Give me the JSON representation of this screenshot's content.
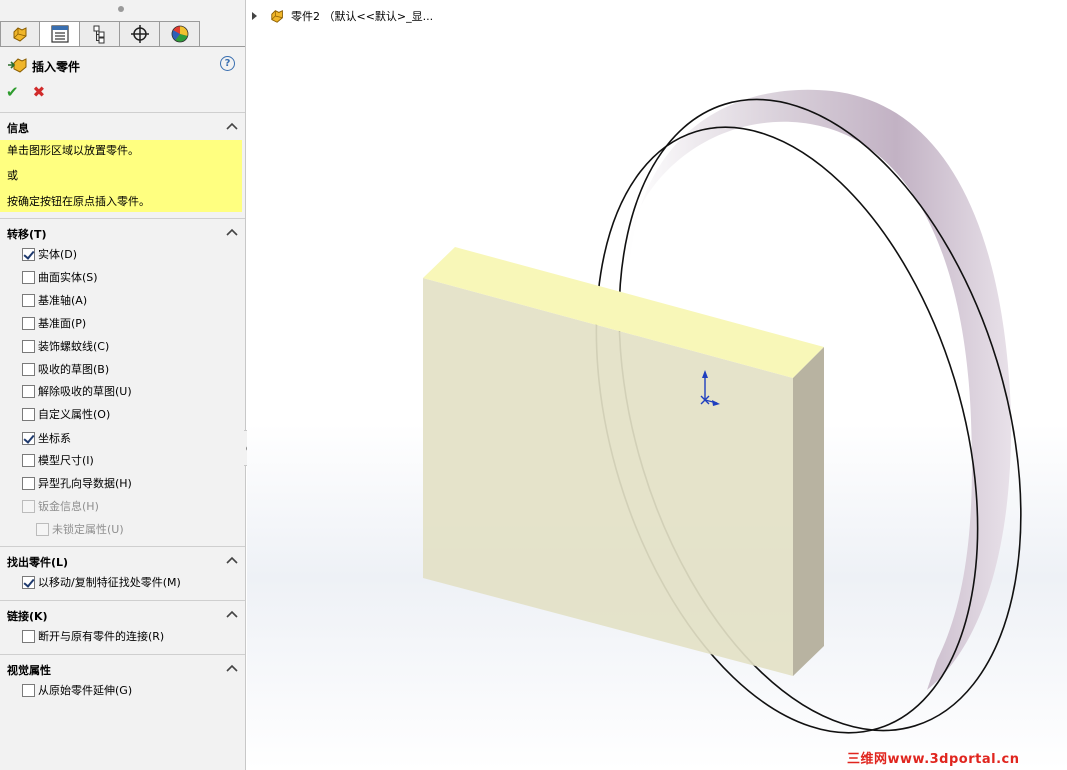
{
  "panel": {
    "tabs": [
      {
        "icon": "feature-manager-icon"
      },
      {
        "icon": "property-manager-icon"
      },
      {
        "icon": "configuration-manager-icon"
      },
      {
        "icon": "dimxpert-icon"
      },
      {
        "icon": "display-manager-icon"
      }
    ],
    "title": "插入零件",
    "help_icon": "?",
    "ok_icon": "✔",
    "cancel_icon": "✖",
    "info": {
      "title": "信息",
      "lines": [
        "单击图形区域以放置零件。",
        "或",
        "按确定按钮在原点插入零件。"
      ]
    },
    "transfer": {
      "title": "转移(T)",
      "items": [
        {
          "label": "实体(D)",
          "checked": true,
          "disabled": false
        },
        {
          "label": "曲面实体(S)",
          "checked": false,
          "disabled": false
        },
        {
          "label": "基准轴(A)",
          "checked": false,
          "disabled": false
        },
        {
          "label": "基准面(P)",
          "checked": false,
          "disabled": false
        },
        {
          "label": "装饰螺蚊线(C)",
          "checked": false,
          "disabled": false
        },
        {
          "label": "吸收的草图(B)",
          "checked": false,
          "disabled": false
        },
        {
          "label": "解除吸收的草图(U)",
          "checked": false,
          "disabled": false
        },
        {
          "label": "自定义属性(O)",
          "checked": false,
          "disabled": false
        },
        {
          "label": "坐标系",
          "checked": true,
          "disabled": false
        },
        {
          "label": "模型尺寸(I)",
          "checked": false,
          "disabled": false
        },
        {
          "label": "异型孔向导数据(H)",
          "checked": false,
          "disabled": false
        },
        {
          "label": "钣金信息(H)",
          "checked": false,
          "disabled": true
        },
        {
          "label": "未锁定属性(U)",
          "checked": false,
          "disabled": true
        }
      ]
    },
    "find_part": {
      "title": "找出零件(L)",
      "items": [
        {
          "label": "以移动/复制特征找处零件(M)",
          "checked": true
        }
      ]
    },
    "link": {
      "title": "链接(K)",
      "items": [
        {
          "label": "断开与原有零件的连接(R)",
          "checked": false
        }
      ]
    },
    "visual": {
      "title": "视觉属性",
      "items": [
        {
          "label": "从原始零件延伸(G)",
          "checked": false
        }
      ]
    }
  },
  "graphics": {
    "breadcrumb": "零件2 （默认<<默认>_显...",
    "breadcrumb_icon": "part-icon",
    "watermark": "三维网www.3dportal.cn",
    "colors": {
      "box_front": "#e3e1c6",
      "box_top": "#f8f7b8",
      "box_side": "#b8b3a1",
      "disc_rim": "#c9b9c9",
      "triad": "#1f3fbf",
      "watermark": "#e0251e"
    }
  }
}
